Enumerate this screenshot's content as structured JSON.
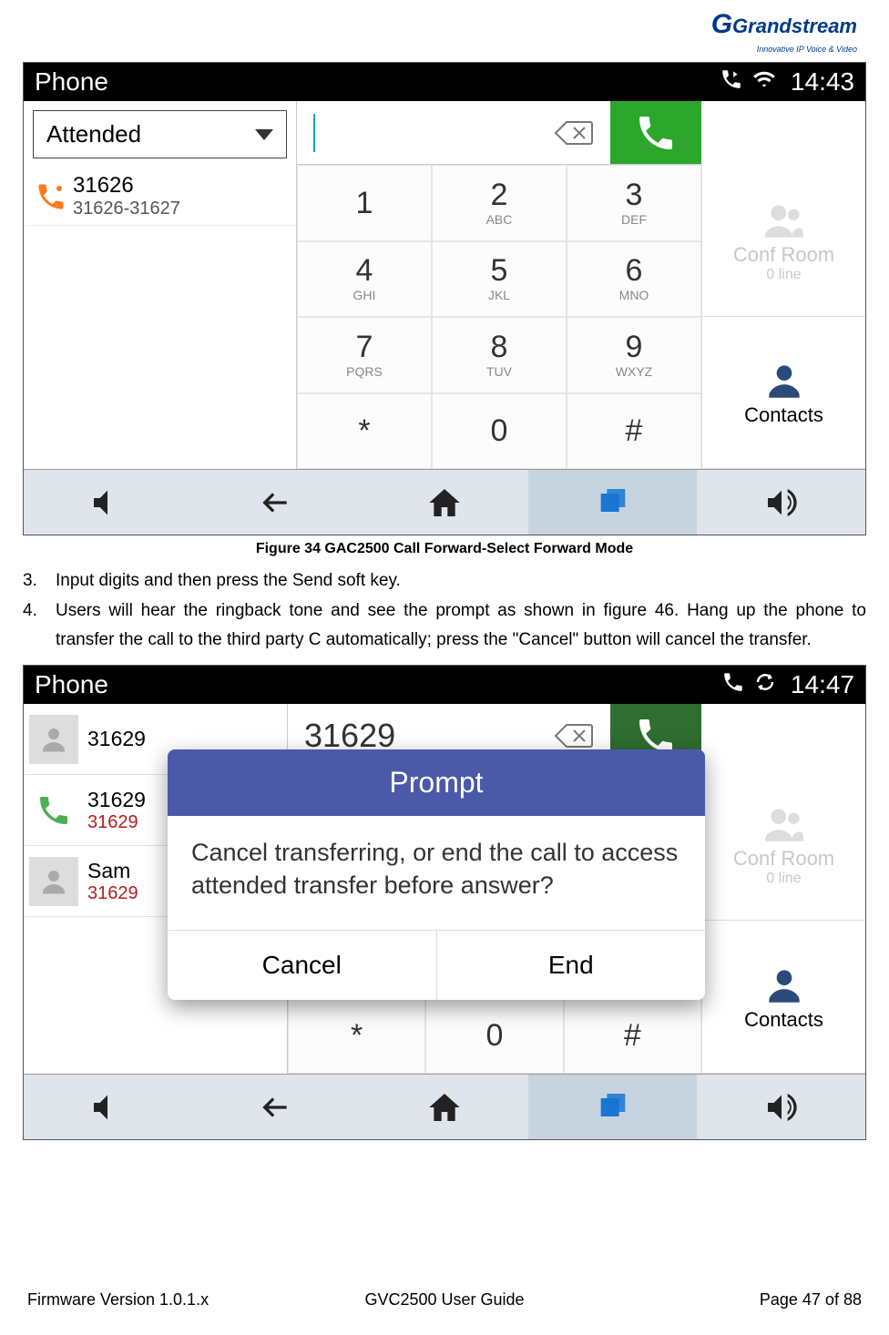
{
  "logo": {
    "text": "Grandstream",
    "tagline": "Innovative IP Voice & Video"
  },
  "fig1": {
    "statusbar": {
      "title": "Phone",
      "time": "14:43"
    },
    "mode": "Attended",
    "recent": {
      "number": "31626",
      "range": "31626-31627"
    },
    "keypad": [
      {
        "d": "1",
        "l": ""
      },
      {
        "d": "2",
        "l": "ABC"
      },
      {
        "d": "3",
        "l": "DEF"
      },
      {
        "d": "4",
        "l": "GHI"
      },
      {
        "d": "5",
        "l": "JKL"
      },
      {
        "d": "6",
        "l": "MNO"
      },
      {
        "d": "7",
        "l": "PQRS"
      },
      {
        "d": "8",
        "l": "TUV"
      },
      {
        "d": "9",
        "l": "WXYZ"
      },
      {
        "d": "*",
        "l": ""
      },
      {
        "d": "0",
        "l": ""
      },
      {
        "d": "#",
        "l": ""
      }
    ],
    "right": {
      "conf": "Conf Room",
      "conf_sub": "0 line",
      "contacts": "Contacts"
    }
  },
  "caption1": "Figure 34 GAC2500 Call Forward-Select Forward Mode",
  "steps": {
    "s3n": "3.",
    "s3": "Input digits and then press the Send soft key.",
    "s4n": "4.",
    "s4": "Users will hear the ringback tone and see the prompt as shown in figure 46. Hang up the phone to transfer the call to the third party C automatically; press the \"Cancel\" button will cancel the transfer."
  },
  "fig2": {
    "statusbar": {
      "title": "Phone",
      "time": "14:47"
    },
    "list": [
      {
        "name": "31629",
        "sub": ""
      },
      {
        "name": "31629",
        "sub": "31629"
      },
      {
        "name": "Sam",
        "sub": "31629"
      }
    ],
    "input": "31629",
    "right": {
      "conf": "Conf Room",
      "conf_sub": "0 line",
      "contacts": "Contacts"
    },
    "bottomrow": [
      {
        "d": "*"
      },
      {
        "d": "0"
      },
      {
        "d": "#"
      }
    ],
    "prompt": {
      "title": "Prompt",
      "body": "Cancel transferring, or end the call to access attended transfer before answer?",
      "cancel": "Cancel",
      "end": "End"
    }
  },
  "footer": {
    "left": "Firmware Version 1.0.1.x",
    "center": "GVC2500 User Guide",
    "right": "Page 47 of 88"
  }
}
